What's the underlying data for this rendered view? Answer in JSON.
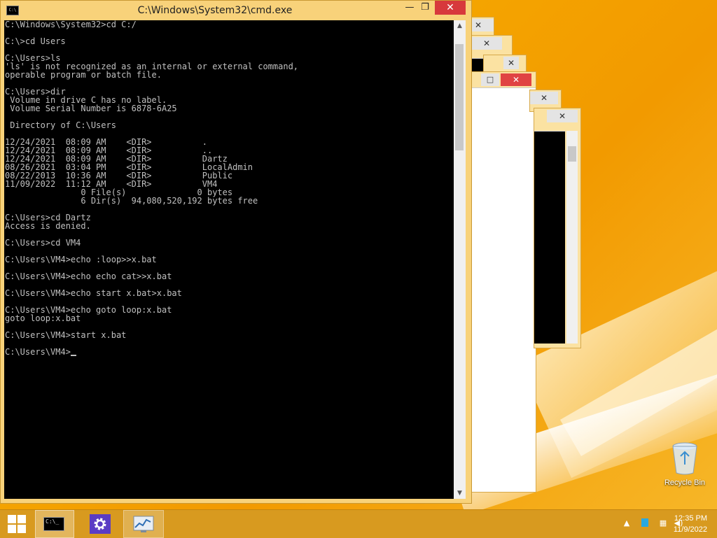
{
  "window": {
    "title": "C:\\Windows\\System32\\cmd.exe",
    "minimize_glyph": "—",
    "maximize_glyph": "❐",
    "close_glyph": "✕"
  },
  "console": {
    "lines": [
      "C:\\Windows\\System32>cd C:/",
      "",
      "C:\\>cd Users",
      "",
      "C:\\Users>ls",
      "'ls' is not recognized as an internal or external command,",
      "operable program or batch file.",
      "",
      "C:\\Users>dir",
      " Volume in drive C has no label.",
      " Volume Serial Number is 6878-6A25",
      "",
      " Directory of C:\\Users",
      "",
      "12/24/2021  08:09 AM    <DIR>          .",
      "12/24/2021  08:09 AM    <DIR>          ..",
      "12/24/2021  08:09 AM    <DIR>          Dartz",
      "08/26/2021  03:04 PM    <DIR>          LocalAdmin",
      "08/22/2013  10:36 AM    <DIR>          Public",
      "11/09/2022  11:12 AM    <DIR>          VM4",
      "               0 File(s)              0 bytes",
      "               6 Dir(s)  94,080,520,192 bytes free",
      "",
      "C:\\Users>cd Dartz",
      "Access is denied.",
      "",
      "C:\\Users>cd VM4",
      "",
      "C:\\Users\\VM4>echo :loop>>x.bat",
      "",
      "C:\\Users\\VM4>echo echo cat>>x.bat",
      "",
      "C:\\Users\\VM4>echo start x.bat>x.bat",
      "",
      "C:\\Users\\VM4>echo goto loop:x.bat",
      "goto loop:x.bat",
      "",
      "C:\\Users\\VM4>start x.bat",
      ""
    ],
    "prompt": "C:\\Users\\VM4>"
  },
  "background_windows": {
    "close_glyph": "✕",
    "minimize_glyph": "□"
  },
  "desktop": {
    "recycle_bin_label": "Recycle Bin"
  },
  "taskbar": {
    "clock_time": "12:35 PM",
    "clock_date": "11/9/2022",
    "cmd_icon_text": "C:\\_",
    "tray": [
      "chevron-up-icon",
      "flag-icon",
      "network-icon",
      "volume-icon"
    ]
  },
  "colors": {
    "console_bg": "#000000",
    "console_fg": "#c0c0c0",
    "close_red": "#d7393c",
    "window_frame": "#f8d27a",
    "taskbar": "#d89a1f"
  }
}
